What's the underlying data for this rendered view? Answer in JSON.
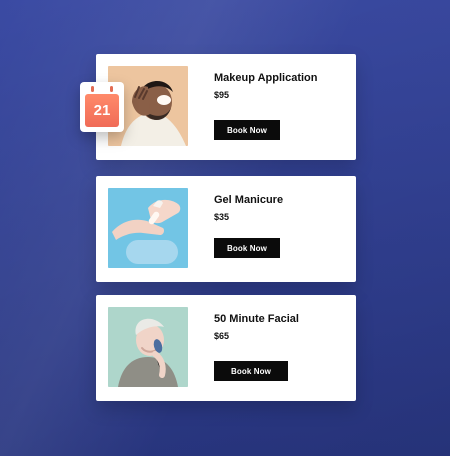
{
  "services": [
    {
      "title": "Makeup Application",
      "price": "$95",
      "button_label": "Book Now"
    },
    {
      "title": "Gel Manicure",
      "price": "$35",
      "button_label": "Book Now"
    },
    {
      "title": "50 Minute Facial",
      "price": "$65",
      "button_label": "Book Now"
    }
  ],
  "calendar": {
    "day": "21",
    "icon": "calendar-icon"
  },
  "colors": {
    "background": "#2f3f94",
    "button": "#0b0b0b",
    "calendar_accent": "#f06b57"
  }
}
